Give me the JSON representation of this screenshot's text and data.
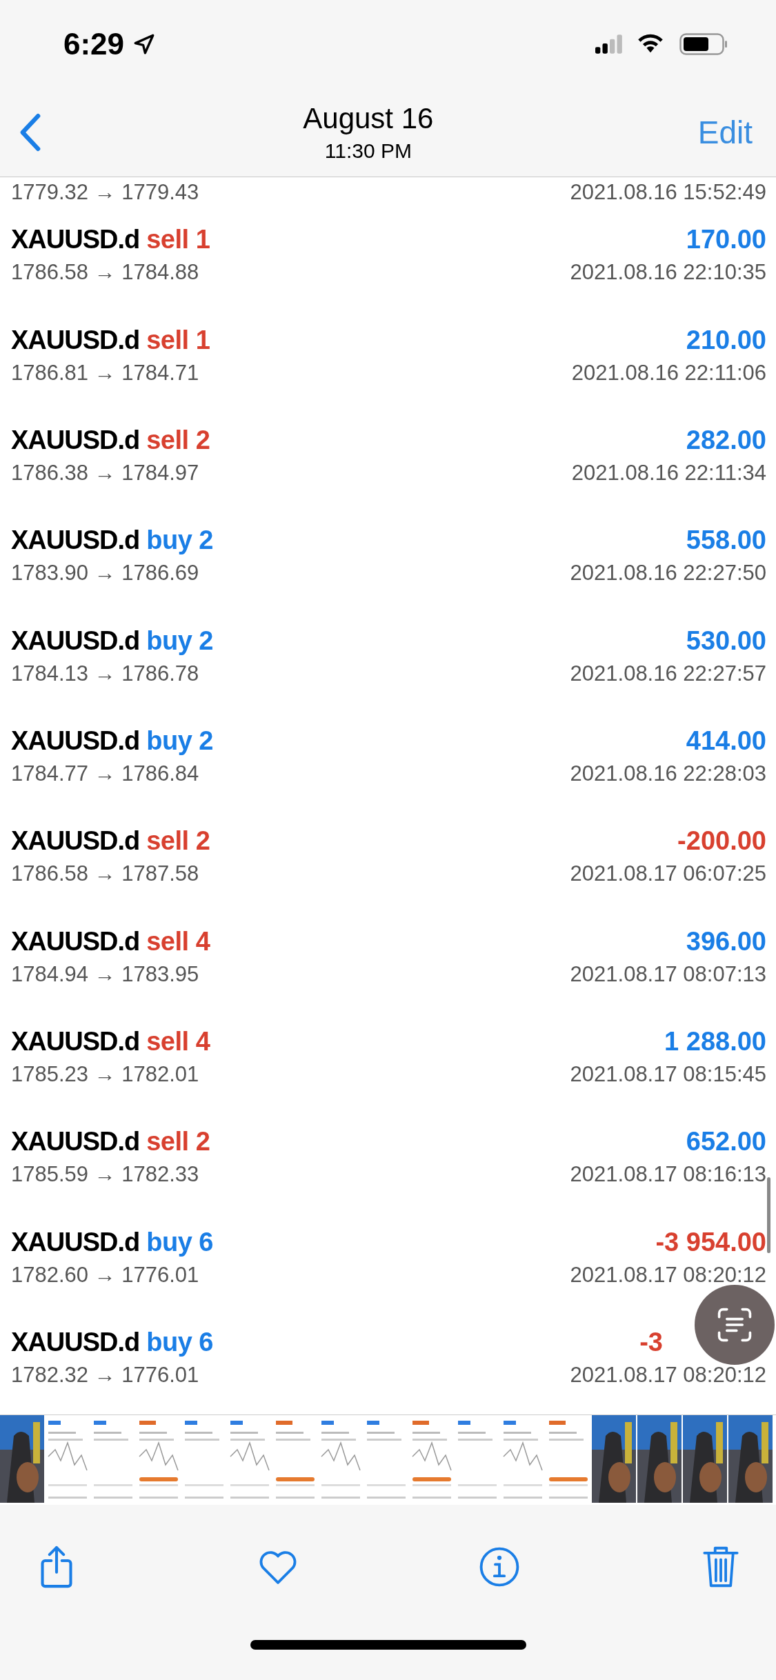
{
  "status_bar": {
    "time": "6:29"
  },
  "nav": {
    "title": "August 16",
    "subtitle": "11:30 PM",
    "edit": "Edit"
  },
  "trades": [
    {
      "prices": "1779.32 → 1779.43",
      "time": "2021.08.16 15:52:49"
    },
    {
      "symbol": "XAUUSD.d",
      "order": "sell 1",
      "color": "#d8402f",
      "amount": "170.00",
      "loss": false,
      "prices": "1786.58 → 1784.88",
      "time": "2021.08.16 22:10:35"
    },
    {
      "symbol": "XAUUSD.d",
      "order": "sell 1",
      "color": "#d8402f",
      "amount": "210.00",
      "loss": false,
      "prices": "1786.81 → 1784.71",
      "time": "2021.08.16 22:11:06"
    },
    {
      "symbol": "XAUUSD.d",
      "order": "sell 2",
      "color": "#d8402f",
      "amount": "282.00",
      "loss": false,
      "prices": "1786.38 → 1784.97",
      "time": "2021.08.16 22:11:34"
    },
    {
      "symbol": "XAUUSD.d",
      "order": "buy 2",
      "color": "#1a7ee6",
      "amount": "558.00",
      "loss": false,
      "prices": "1783.90 → 1786.69",
      "time": "2021.08.16 22:27:50"
    },
    {
      "symbol": "XAUUSD.d",
      "order": "buy 2",
      "color": "#1a7ee6",
      "amount": "530.00",
      "loss": false,
      "prices": "1784.13 → 1786.78",
      "time": "2021.08.16 22:27:57"
    },
    {
      "symbol": "XAUUSD.d",
      "order": "buy 2",
      "color": "#1a7ee6",
      "amount": "414.00",
      "loss": false,
      "prices": "1784.77 → 1786.84",
      "time": "2021.08.16 22:28:03"
    },
    {
      "symbol": "XAUUSD.d",
      "order": "sell 2",
      "color": "#d8402f",
      "amount": "-200.00",
      "loss": true,
      "prices": "1786.58 → 1787.58",
      "time": "2021.08.17 06:07:25"
    },
    {
      "symbol": "XAUUSD.d",
      "order": "sell 4",
      "color": "#d8402f",
      "amount": "396.00",
      "loss": false,
      "prices": "1784.94 → 1783.95",
      "time": "2021.08.17 08:07:13"
    },
    {
      "symbol": "XAUUSD.d",
      "order": "sell 4",
      "color": "#d8402f",
      "amount": "1 288.00",
      "loss": false,
      "prices": "1785.23 → 1782.01",
      "time": "2021.08.17 08:15:45"
    },
    {
      "symbol": "XAUUSD.d",
      "order": "sell 2",
      "color": "#d8402f",
      "amount": "652.00",
      "loss": false,
      "prices": "1785.59 → 1782.33",
      "time": "2021.08.17 08:16:13"
    },
    {
      "symbol": "XAUUSD.d",
      "order": "buy 6",
      "color": "#1a7ee6",
      "amount": "-3 954.00",
      "loss": true,
      "prices": "1782.60 → 1776.01",
      "time": "2021.08.17 08:20:12"
    },
    {
      "symbol": "XAUUSD.d",
      "order": "buy 6",
      "color": "#1a7ee6",
      "amount": "-3",
      "loss": true,
      "prices": "1782.32 → 1776.01",
      "time": "2021.08.17 08:20:12"
    }
  ]
}
